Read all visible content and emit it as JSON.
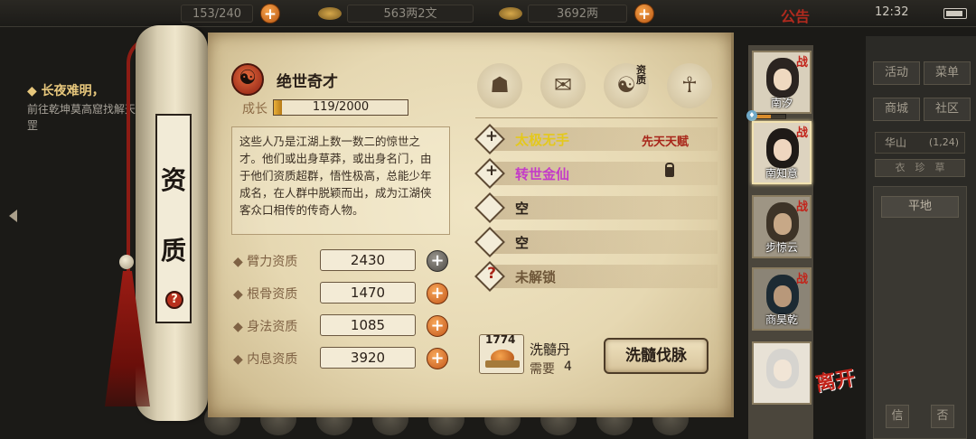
{
  "topbar": {
    "res1": "153/240",
    "res2": "563两2文",
    "res3": "3692两",
    "notice": "公告",
    "time": "12:32"
  },
  "background": {
    "quest_title": "长夜难明，",
    "quest_desc": "前往乾坤莫高窟找解天罡",
    "location": "华山",
    "location_sub": "(1,24)",
    "strip_label": "衣　珍　草",
    "terrain": "平地",
    "buttons": [
      "活动",
      "菜单",
      "商城",
      "社区"
    ],
    "bottom_buttons": [
      "信",
      "否"
    ]
  },
  "scroll": {
    "label_top": "资",
    "label_bottom": "质",
    "help_glyph": "?"
  },
  "talent": {
    "name": "绝世奇才",
    "growth_label": "成长",
    "growth_text": "119/2000",
    "growth_fraction": 0.0595,
    "description": "这些人乃是江湖上数一数二的惊世之才。他们或出身草莽，或出身名门，由于他们资质超群，悟性极高，总能少年成名，在人群中脱颖而出，成为江湖侠客众口相传的传奇人物。"
  },
  "stats": [
    {
      "name": "臂力资质",
      "value": "2430",
      "plus": "+",
      "style": "grey"
    },
    {
      "name": "根骨资质",
      "value": "1470",
      "plus": "+",
      "style": "orange"
    },
    {
      "name": "身法资质",
      "value": "1085",
      "plus": "+",
      "style": "orange"
    },
    {
      "name": "内息资质",
      "value": "3920",
      "plus": "+",
      "style": "orange"
    }
  ],
  "tabs": [
    {
      "icon": "straw-hat-character-icon",
      "glyph": "☗",
      "text": ""
    },
    {
      "icon": "scroll-map-icon",
      "glyph": "✉",
      "text": ""
    },
    {
      "icon": "bagua-aptitude-icon",
      "glyph": "☯",
      "text": "资质"
    },
    {
      "icon": "body-figure-icon",
      "glyph": "☥",
      "text": ""
    }
  ],
  "slots": [
    {
      "glyph": "+",
      "name": "太极无手",
      "name_color": "#e4c81c",
      "tag": "先天天赋",
      "locked": false
    },
    {
      "glyph": "+",
      "name": "转世金仙",
      "name_color": "#c43bc8",
      "tag": "",
      "locked": true
    },
    {
      "glyph": "",
      "name": "空",
      "name_color": "#2a2018",
      "tag": "",
      "locked": false
    },
    {
      "glyph": "",
      "name": "空",
      "name_color": "#2a2018",
      "tag": "",
      "locked": false
    },
    {
      "glyph": "?",
      "name": "未解锁",
      "name_color": "#6e5638",
      "tag": "",
      "locked": false
    }
  ],
  "pill": {
    "count": "1774",
    "name": "洗髓丹",
    "need_label": "需要",
    "need": "4",
    "button": "洗髓伐脉"
  },
  "characters": [
    {
      "name": "南汐",
      "badge": "战",
      "hair": "#2b2420",
      "face": "#efd9c0",
      "bg": "#d9d0bc",
      "selected": false,
      "hp": 0.6
    },
    {
      "name": "南知意",
      "badge": "战",
      "hair": "#1f1a17",
      "face": "#efd6bf",
      "bg": "#ddd3bf",
      "selected": true
    },
    {
      "name": "步惊云",
      "badge": "战",
      "hair": "#3d3327",
      "face": "#c7a887",
      "bg": "#9e9584"
    },
    {
      "name": "商昊乾",
      "badge": "战",
      "hair": "#1c2a33",
      "face": "#b8987a",
      "bg": "#8b8476"
    },
    {
      "name": "",
      "badge": "",
      "hair": "#d6d4cf",
      "face": "#f1e5d6",
      "bg": "#e8e2d6"
    }
  ],
  "leave_label": "离开",
  "bottom_nav": [
    "",
    "",
    "",
    "",
    "",
    "",
    "",
    "",
    ""
  ],
  "colors": {
    "accent_red": "#c2231a",
    "gold": "#e4c81c",
    "purple": "#c43bc8"
  }
}
